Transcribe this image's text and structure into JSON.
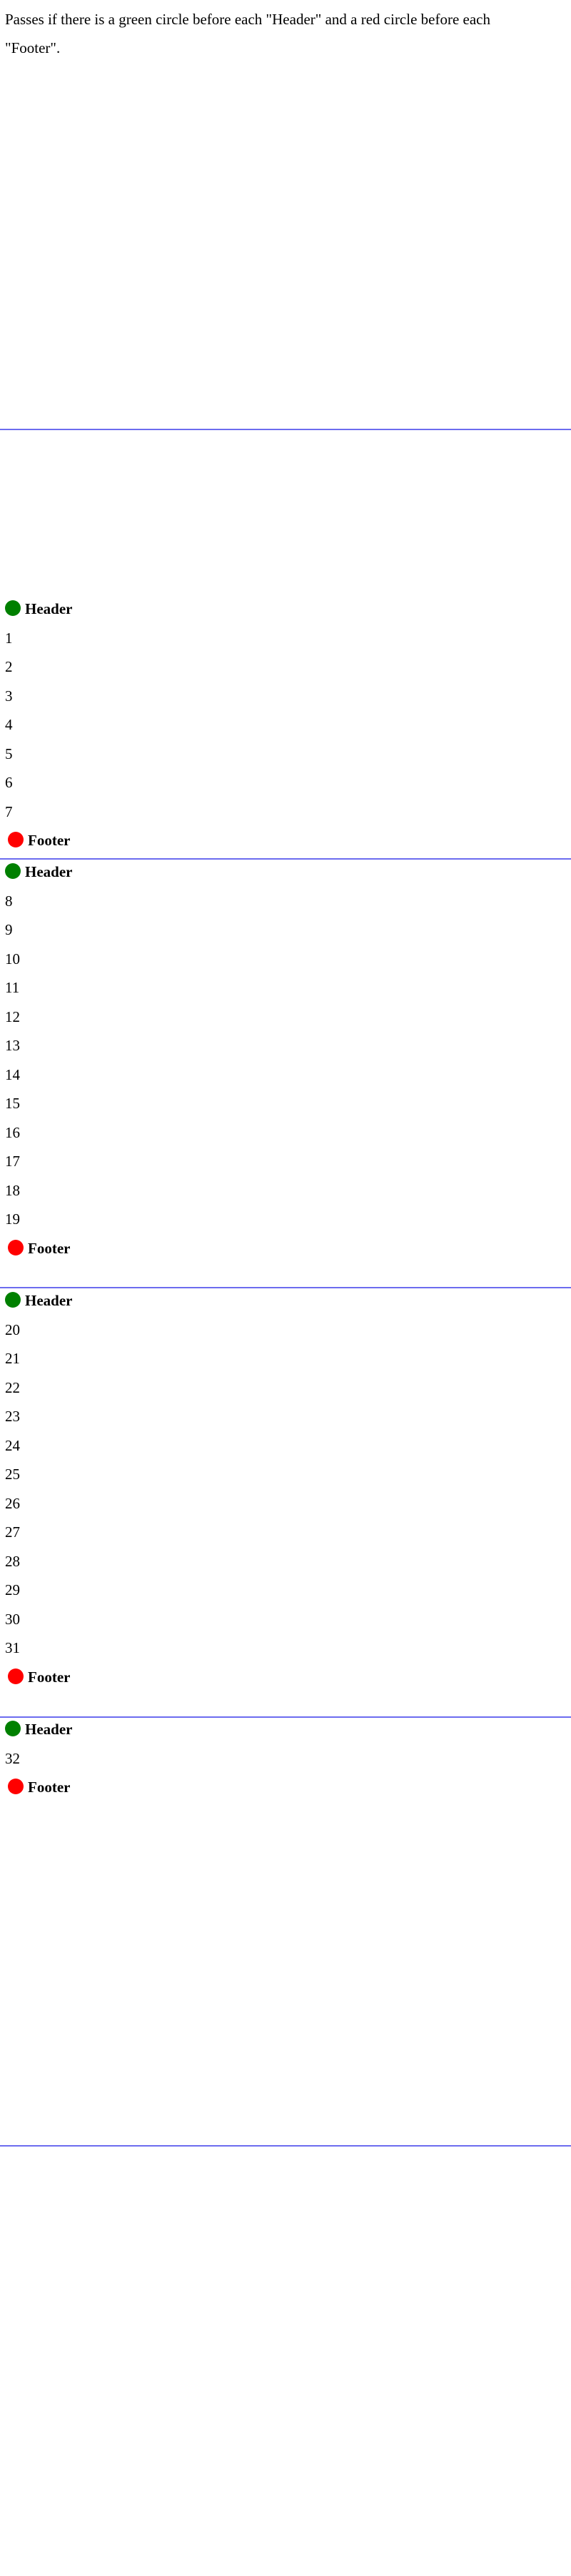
{
  "intro_text": "Passes if there is a green circle before each \"Header\" and a red circle before each \"Footer\".",
  "header_label": "Header",
  "footer_label": "Footer",
  "colors": {
    "header_circle": "#008000",
    "footer_circle": "#ff0000",
    "page_divider": "#6c6cef"
  },
  "groups": [
    {
      "items": [
        "1",
        "2",
        "3",
        "4",
        "5",
        "6",
        "7"
      ]
    },
    {
      "items": [
        "8",
        "9",
        "10",
        "11",
        "12",
        "13",
        "14",
        "15",
        "16",
        "17",
        "18",
        "19"
      ]
    },
    {
      "items": [
        "20",
        "21",
        "22",
        "23",
        "24",
        "25",
        "26",
        "27",
        "28",
        "29",
        "30",
        "31"
      ]
    },
    {
      "items": [
        "32"
      ]
    }
  ]
}
